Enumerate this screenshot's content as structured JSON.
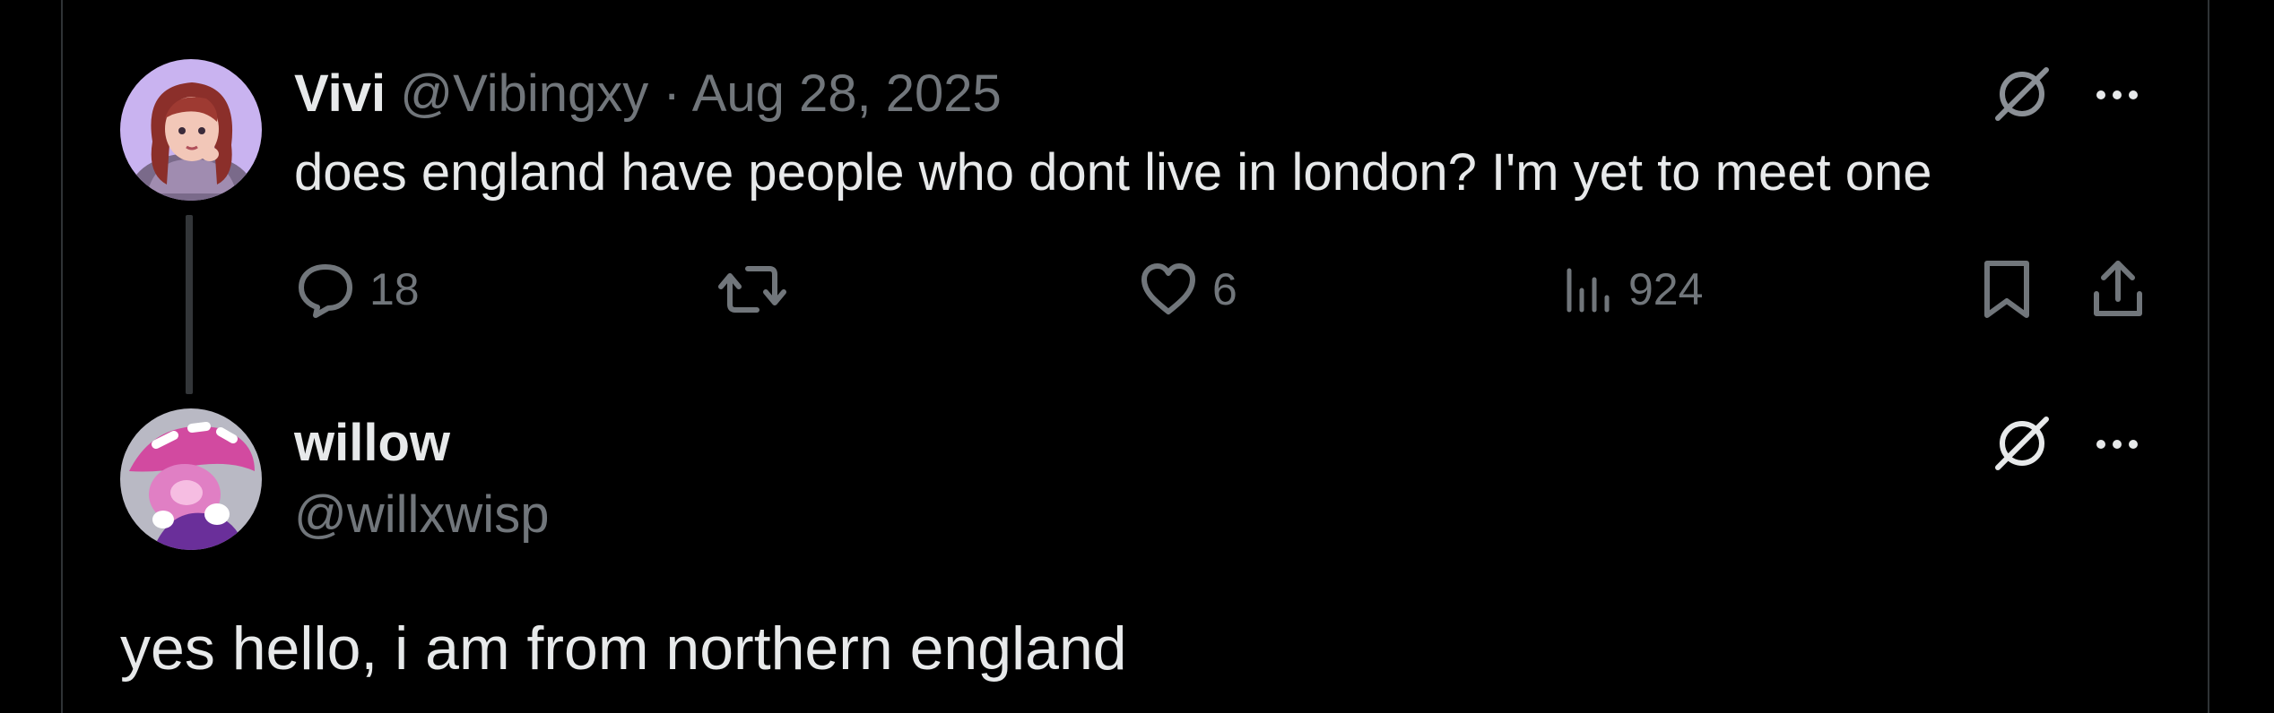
{
  "parent_post": {
    "display_name": "Vivi",
    "handle": "@Vibingxy",
    "separator": "·",
    "date": "Aug 28, 2025",
    "text": "does england have people who dont live in london? I'm yet to meet one",
    "avatar_icon": "avatar-vivi",
    "actions": {
      "reply_count": "18",
      "repost_count": "",
      "like_count": "6",
      "view_count": "924"
    }
  },
  "reply_post": {
    "display_name": "willow",
    "handle": "@willxwisp",
    "text": "yes hello, i am from northern england",
    "avatar_icon": "avatar-willow"
  },
  "icons": {
    "grok": "grok-icon",
    "more": "more-icon",
    "reply": "reply-icon",
    "repost": "repost-icon",
    "like": "like-icon",
    "views": "views-icon",
    "bookmark": "bookmark-icon",
    "share": "share-icon"
  },
  "colors": {
    "background": "#000000",
    "text_primary": "#e7e9ea",
    "text_secondary": "#71767b",
    "border": "#2f3336"
  }
}
